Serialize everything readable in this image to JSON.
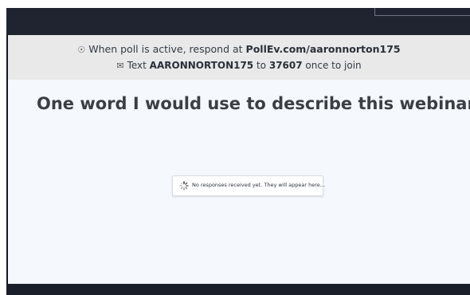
{
  "banner": {
    "line1_prefix": "When poll is active, respond at ",
    "line1_link": "PollEv.com/aaronnorton175",
    "line2_prefix": "Text ",
    "line2_code": "AARONNORTON175",
    "line2_mid": " to ",
    "line2_number": "37607",
    "line2_suffix": " once to join",
    "icon1": "globe-icon",
    "icon2": "sms-icon"
  },
  "poll": {
    "question": "One word I would use to describe this webinar is",
    "status": "No responses received yet. They will appear here..."
  },
  "colors": {
    "banner_bg": "#e9e9ea",
    "poll_bg": "#f5f9fd",
    "chrome": "#1f2430"
  }
}
